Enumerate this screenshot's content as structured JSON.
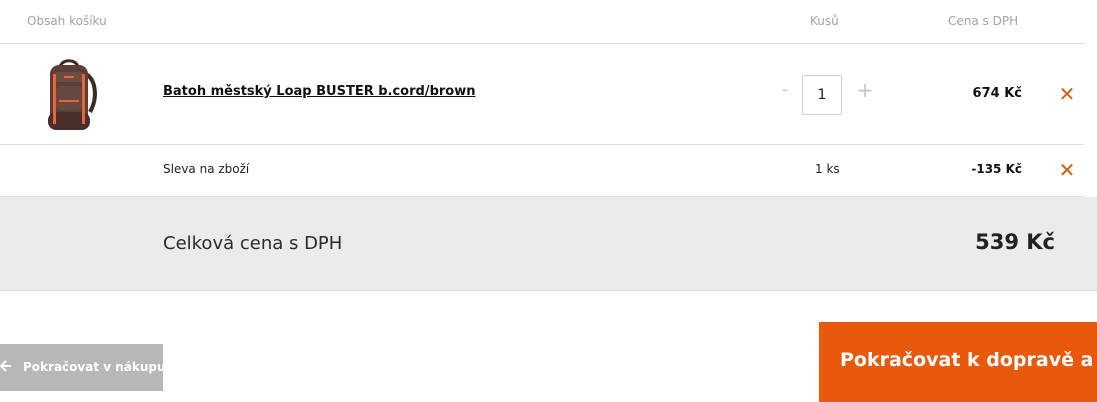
{
  "header": {
    "content_label": "Obsah košíku",
    "qty_label": "Kusů",
    "price_label": "Cena s DPH"
  },
  "product": {
    "name": "Batoh městský Loap BUSTER b.cord/brown",
    "quantity": "1",
    "minus_label": "-",
    "plus_label": "+",
    "price": "674 Kč",
    "remove_icon": "close-icon",
    "image_icon": "backpack-icon"
  },
  "discount": {
    "name": "Sleva na zboží",
    "quantity": "1 ks",
    "price": "-135 Kč",
    "remove_icon": "close-icon"
  },
  "total": {
    "label": "Celková cena s DPH",
    "price": "539 Kč"
  },
  "buttons": {
    "back_label": "Pokračovat v nákupu",
    "back_icon": "arrow-left-icon",
    "next_label": "Pokračovat k dopravě a platbě"
  },
  "colors": {
    "accent": "#e8590c",
    "remove": "#d55c17",
    "total_bg": "#ebebeb",
    "back_button": "#b7b7b7"
  }
}
